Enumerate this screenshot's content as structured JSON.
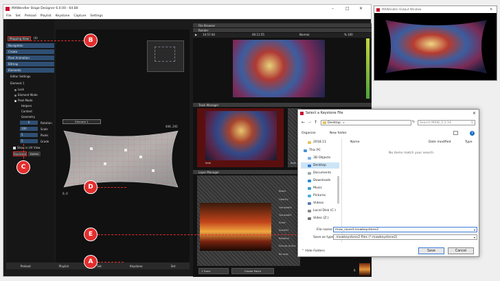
{
  "main_window": {
    "title": "MXWendler Stage Designer 6.0.00  -  64 Bit",
    "menu": [
      "File",
      "Set",
      "Preload",
      "Playlist",
      "Keystone",
      "Capture",
      "Settings"
    ]
  },
  "left_panel": {
    "mapping_view_label": "Mapping View",
    "sections": [
      "Navigation",
      "Create",
      "Pixel Animation",
      "Bitmap",
      "Elements"
    ],
    "editor_settings": "Editor Settings",
    "element_label": "Element 1",
    "element_items": [
      "Lock",
      "Element Mode",
      "Pixel Mode"
    ],
    "sub_items": [
      "Helpers",
      "Content",
      "Geometry"
    ],
    "geometry_fields": [
      {
        "value": "0",
        "label": "Rotation"
      },
      {
        "value": "100",
        "label": "Scale"
      },
      {
        "value": "5",
        "label": "Pixels"
      },
      {
        "value": "5",
        "label": "Grade"
      }
    ],
    "show_in_uv_view": "Show in UV View",
    "duplicate_label": "Duplicate",
    "delete_label": "Delete"
  },
  "canvas": {
    "element_label": "Element 1",
    "coord_top": "444, 241",
    "coord_bottom": "0, 0"
  },
  "bottom_tabs": [
    "Preload",
    "Playlist",
    "Set",
    "Keystone",
    "Set"
  ],
  "right_panel": {
    "file_browser": "File Browser",
    "render": "Render",
    "time_left": "14:57:44",
    "time_mid": "00:11:55",
    "mode": "Normal",
    "percent": "% 100",
    "track_manager": "Track Manager",
    "fade_label": "fade",
    "fade_label2": "fade",
    "layer_manager": "Layer Manager",
    "layer_props": [
      "Reset",
      "Opacity",
      "TranslateX",
      "TranslateY",
      "Scale",
      "ScaleXY",
      "Rotation",
      "Picture-In-Pict",
      "Re-map"
    ],
    "track_button": "1 Track",
    "create_patch": "Create Patch",
    "counter": "6"
  },
  "output_window": {
    "title": "MXWendler Output Window"
  },
  "dialog": {
    "title": "Select a Keystone File",
    "path": [
      "Desktop",
      "»"
    ],
    "search_placeholder": "Search MXW_5.2.14",
    "organize": "Organize",
    "new_folder": "New folder",
    "nav_items": [
      "2018.11",
      "This PC",
      "3D Objects",
      "Desktop",
      "Documents",
      "Downloads",
      "Music",
      "Pictures",
      "Videos",
      "Local Disk (C:)",
      "Video (Z:)"
    ],
    "columns": [
      "Name",
      "Date modified",
      "Type"
    ],
    "empty_message": "No items match your search.",
    "file_name_label": "File name:",
    "file_name_value": "mxw_saved.mxwkeystone2",
    "save_type_label": "Save as type:",
    "save_type_value": ".mxwkeystone2 files (*.mxwkeystone2)",
    "hide_folders": "Hide Folders",
    "save_button": "Save",
    "cancel_button": "Cancel"
  },
  "callouts": [
    "A",
    "B",
    "C",
    "D",
    "E"
  ],
  "colors": {
    "accent": "#e52d2d",
    "section_header": "#2f4f73",
    "selection": "#cce4f7"
  }
}
